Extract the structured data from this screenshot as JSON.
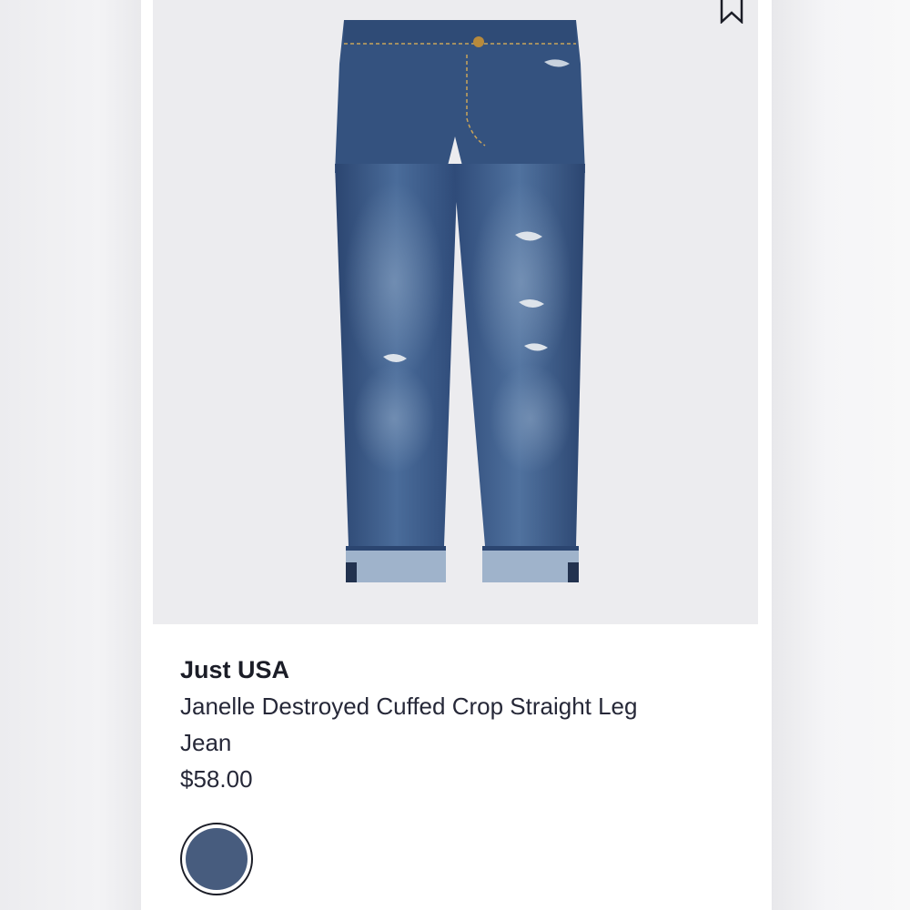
{
  "product": {
    "brand": "Just USA",
    "name": "Janelle Destroyed Cuffed Crop Straight Leg Jean",
    "price": "$58.00",
    "image_icon": "jeans-product-image",
    "save_icon": "bookmark-icon"
  },
  "swatches": [
    {
      "color": "#475c7e",
      "selected": true
    }
  ],
  "colors": {
    "denim": "#3a5a8a",
    "denim_dark": "#2b4570",
    "image_background": "#ececef",
    "text": "#1b1d27"
  }
}
